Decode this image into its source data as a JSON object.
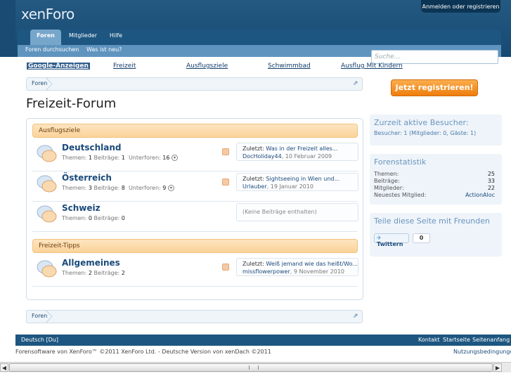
{
  "header": {
    "logo_text": "xenForo",
    "login_link": "Anmelden oder registrieren",
    "tabs": [
      {
        "label": "Foren"
      },
      {
        "label": "Mitglieder"
      },
      {
        "label": "Hilfe"
      }
    ],
    "subnav": [
      {
        "label": "Foren durchsuchen"
      },
      {
        "label": "Was ist neu?"
      }
    ],
    "search_placeholder": "Suche..."
  },
  "ads": [
    {
      "label": "Google-Anzeigen"
    },
    {
      "label": "Freizeit"
    },
    {
      "label": "Ausflugsziele"
    },
    {
      "label": "Schwimmbad"
    },
    {
      "label": "Ausflug Mit Kindern"
    }
  ],
  "breadcrumb": {
    "label": "Foren"
  },
  "page_title": "Freizeit-Forum",
  "categories": [
    {
      "title": "Ausflugsziele",
      "nodes": [
        {
          "name": "Deutschland",
          "threads_label": "Themen:",
          "threads": "1",
          "posts_label": "Beiträge:",
          "posts": "1",
          "sub_label": "Unterforen:",
          "sub": "16",
          "last_prefix": "Zuletzt:",
          "last_title": "Was in der Freizeit alles...",
          "last_user": "DocHoliday44",
          "last_date": ", 10 Februar 2009"
        },
        {
          "name": "Österreich",
          "threads_label": "Themen:",
          "threads": "3",
          "posts_label": "Beiträge:",
          "posts": "8",
          "sub_label": "Unterforen:",
          "sub": "9",
          "last_prefix": "Zuletzt:",
          "last_title": "Sightseeing in Wien und...",
          "last_user": "Urlauber",
          "last_date": ", 19 Januar 2010"
        },
        {
          "name": "Schweiz",
          "threads_label": "Themen:",
          "threads": "0",
          "posts_label": "Beiträge:",
          "posts": "0",
          "empty_text": "(Keine Beiträge enthalten)"
        }
      ]
    },
    {
      "title": "Freizeit-Tipps",
      "nodes": [
        {
          "name": "Allgemeines",
          "threads_label": "Themen:",
          "threads": "2",
          "posts_label": "Beiträge:",
          "posts": "2",
          "last_prefix": "Zuletzt:",
          "last_title": "Weiß jemand wie das heißt/Wo...",
          "last_user": "missflowerpower",
          "last_date": ", 9 November 2010"
        }
      ]
    }
  ],
  "sidebar": {
    "register_label": "Jetzt registrieren!",
    "visitors_title": "Zurzeit aktive Besucher:",
    "visitors_line": "Besucher: 1 (Mitglieder: 0, Gäste: 1)",
    "stats_title": "Forenstatistik",
    "stats": [
      {
        "label": "Themen:",
        "value": "25"
      },
      {
        "label": "Beiträge:",
        "value": "33"
      },
      {
        "label": "Mitglieder:",
        "value": "22"
      },
      {
        "label": "Neuestes Mitglied:",
        "value": "ActionAloc"
      }
    ],
    "share_title": "Teile diese Seite mit Freunden",
    "twitter_label": "Twittern",
    "twitter_count": "0"
  },
  "footer": {
    "language": "Deutsch [Du]",
    "links": [
      {
        "label": "Kontakt"
      },
      {
        "label": "Startseite"
      },
      {
        "label": "Seitenanfang"
      }
    ],
    "copyright": "Forensoftware von XenForo™ ©2011 XenForo Ltd. - Deutsche Version von xenDach ©2011",
    "terms": "Nutzungsbedingungen"
  },
  "colors": {
    "accent": "#1d5680",
    "register": "#ee7d0d",
    "category": "#fbd39a"
  }
}
